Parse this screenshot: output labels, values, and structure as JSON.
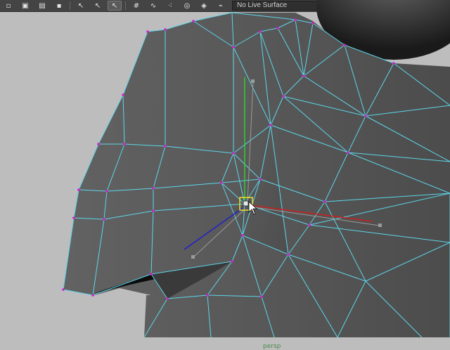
{
  "toolbar": {
    "buttons": [
      {
        "icon": "new-scene-icon",
        "glyph": "▫"
      },
      {
        "icon": "image-icon",
        "glyph": "▣"
      },
      {
        "icon": "open-folder-icon",
        "glyph": "▤"
      },
      {
        "icon": "save-icon",
        "glyph": "▪"
      },
      {
        "icon": "select-tool-icon",
        "glyph": "↖"
      },
      {
        "icon": "lasso-tool-icon",
        "glyph": "↖"
      },
      {
        "icon": "paint-select-icon",
        "glyph": "↖"
      },
      {
        "icon": "snap-grid-icon",
        "glyph": "#"
      },
      {
        "icon": "snap-curve-icon",
        "glyph": "∿"
      },
      {
        "icon": "snap-point-icon",
        "glyph": "⁖"
      },
      {
        "icon": "snap-view-plane-icon",
        "glyph": "◎"
      },
      {
        "icon": "make-live-icon",
        "glyph": "◈"
      },
      {
        "icon": "magnet-icon",
        "glyph": "⌁"
      }
    ],
    "live_surface_text": "No Live Surface",
    "right_buttons": [
      {
        "icon": "render-view-icon",
        "glyph": "▣"
      },
      {
        "icon": "render-frame-icon",
        "glyph": "▦"
      },
      {
        "icon": "ipr-render-icon",
        "glyph": "▩"
      },
      {
        "icon": "render-settings-icon",
        "glyph": "▨"
      }
    ]
  },
  "viewport": {
    "camera_label": "persp",
    "colors": {
      "mesh_fill": "#5a5a5a",
      "wireframe": "#5cd6ea",
      "vertex": "#d020d0",
      "manip_y": "#30d030",
      "manip_x": "#cc2020",
      "manip_z": "#2020cc",
      "selection": "#f0e020",
      "background": "#bdbdbd"
    }
  }
}
